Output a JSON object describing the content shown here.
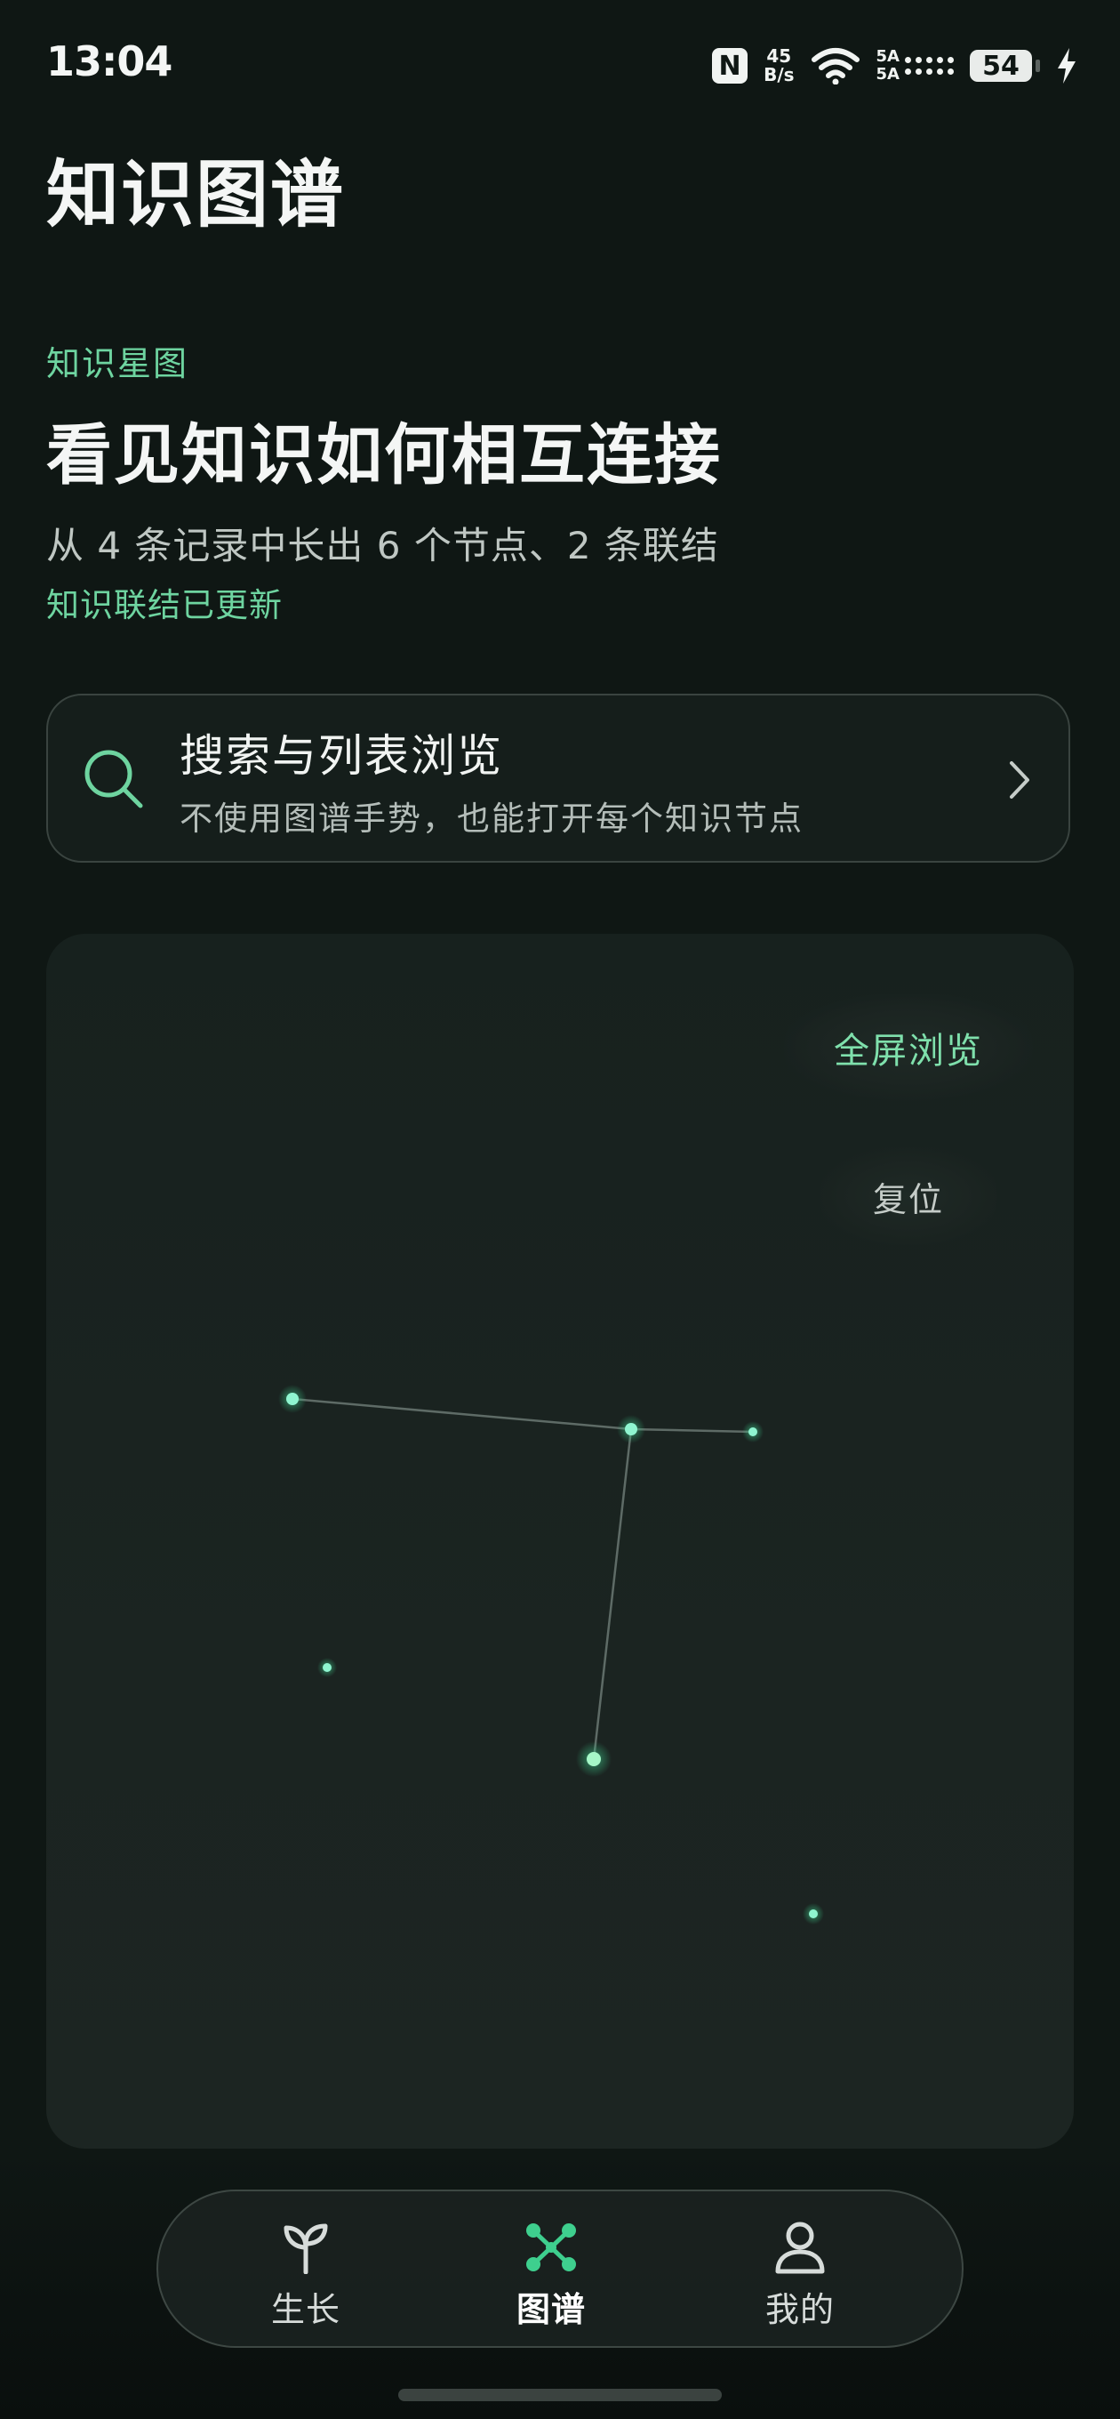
{
  "status_bar": {
    "time": "13:04",
    "network_speed_value": "45",
    "network_speed_unit": "B/s",
    "signal_label_top": "5A",
    "signal_label_bottom": "5A",
    "battery": "54"
  },
  "header": {
    "title": "知识图谱"
  },
  "hero": {
    "eyebrow": "知识星图",
    "headline": "看见知识如何相互连接",
    "summary": "从 4 条记录中长出 6 个节点、2 条联结",
    "status": "知识联结已更新"
  },
  "search_card": {
    "title": "搜索与列表浏览",
    "subtitle": "不使用图谱手势，也能打开每个知识节点"
  },
  "graph": {
    "fullscreen_label": "全屏浏览",
    "reset_label": "复位",
    "node_count": 6,
    "edge_count": 2,
    "accent_color": "#5ee0b0"
  },
  "bottom_nav": {
    "items": [
      {
        "label": "生长",
        "icon": "sprout-icon",
        "active": false
      },
      {
        "label": "图谱",
        "icon": "graph-nodes-icon",
        "active": true
      },
      {
        "label": "我的",
        "icon": "person-icon",
        "active": false
      }
    ],
    "active_color": "#3ecf8e"
  }
}
